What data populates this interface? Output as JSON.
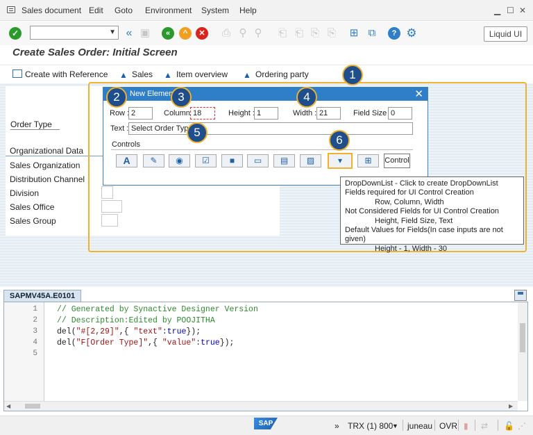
{
  "menu": [
    "Sales document",
    "Edit",
    "Goto",
    "Environment",
    "System",
    "Help"
  ],
  "toolbar": {
    "liquid_ui": "Liquid UI"
  },
  "page_title": "Create Sales Order: Initial Screen",
  "actions": [
    "Create with Reference",
    "Sales",
    "Item overview",
    "Ordering party"
  ],
  "form": {
    "order_type": "Order Type",
    "org_data": "Organizational Data",
    "fields": [
      "Sales Organization",
      "Distribution Channel",
      "Division",
      "Sales Office",
      "Sales Group"
    ]
  },
  "dialog": {
    "title": "New Element",
    "row_label": "Row :",
    "row_value": "2",
    "column_label": "Column :",
    "column_value": "18",
    "height_label": "Height :",
    "height_value": "1",
    "width_label": "Width :",
    "width_value": "21",
    "fieldsize_label": "Field Size :",
    "fieldsize_value": "0",
    "text_label": "Text :",
    "text_value": "Select Order Type",
    "controls_label": "Controls",
    "control_button": "Control"
  },
  "tooltip": {
    "lines": [
      "DropDownList - Click to create DropDownList",
      "Fields required for UI Control Creation",
      "Row, Column, Width",
      "Not Considered Fields for UI Control Creation",
      "Height, Field Size, Text",
      "Default Values for Fields(In case inputs are not given)",
      "Height - 1, Width - 30"
    ]
  },
  "badges": [
    "1",
    "2",
    "3",
    "4",
    "5",
    "6"
  ],
  "editor": {
    "tab": "SAPMV45A.E0101",
    "line_numbers": [
      "1",
      "2",
      "3",
      "4",
      "5"
    ],
    "code": {
      "l1": "// Generated by Synactive Designer Version",
      "l2": "// Description:Edited by POOJITHA",
      "l3a": "del(",
      "l3b": "\"#[2,29]\"",
      "l3c": ",{ ",
      "l3d": "\"text\"",
      "l3e": ":",
      "l3f": "true",
      "l3g": "});",
      "l4a": "del(",
      "l4b": "\"F[Order Type]\"",
      "l4c": ",{ ",
      "l4d": "\"value\"",
      "l4e": ":",
      "l4f": "true",
      "l4g": "});"
    }
  },
  "status": {
    "sap": "SAP",
    "arrows": "»",
    "trx": "TRX (1) 800",
    "user": "juneau",
    "mode": "OVR"
  }
}
